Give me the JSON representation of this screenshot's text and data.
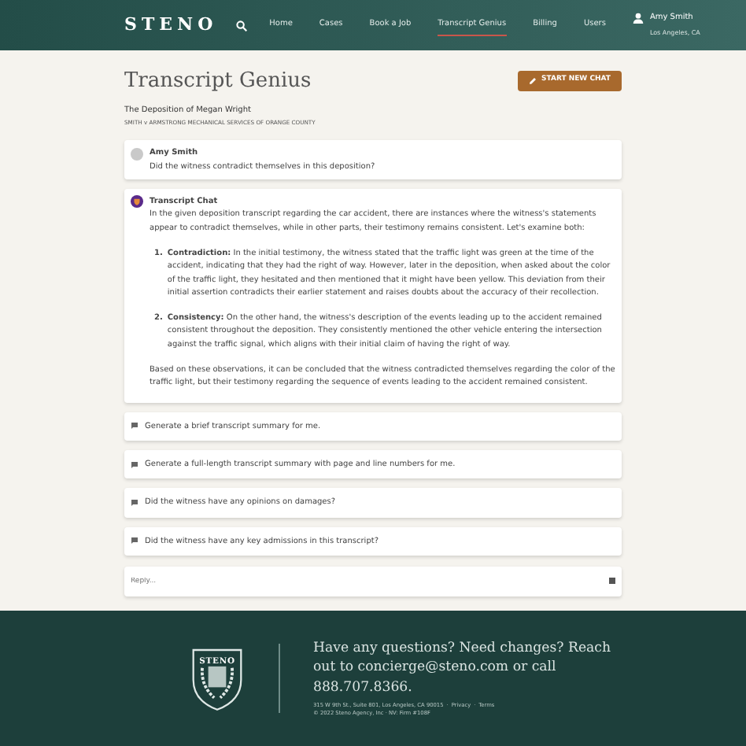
{
  "header": {
    "logo": "STENO",
    "nav": [
      {
        "label": "Home",
        "selected": false
      },
      {
        "label": "Cases",
        "selected": false
      },
      {
        "label": "Book a Job",
        "selected": false
      },
      {
        "label": "Transcript Genius",
        "selected": true
      },
      {
        "label": "Billing",
        "selected": false
      },
      {
        "label": "Users",
        "selected": false
      }
    ],
    "user": {
      "name": "Amy Smith",
      "location": "Los Angeles, CA"
    }
  },
  "page": {
    "title": "Transcript Genius",
    "button": "START NEW CHAT",
    "case_title": "The Deposition of Megan Wright",
    "case_subtitle": "SMITH v ARMSTRONG MECHANICAL SERVICES OF ORANGE COUNTY"
  },
  "messages": [
    {
      "kind": "user",
      "author": "Amy Smith",
      "text": "Did the witness contradict themselves in this deposition?"
    },
    {
      "kind": "bot",
      "author": "Transcript Chat",
      "intro": "In the given deposition transcript regarding the car accident, there are instances where the witness's statements appear to contradict themselves, while in other parts, their testimony remains consistent. Let's examine both:",
      "points": [
        {
          "number": "1.",
          "text": "**Contradiction:** In the initial testimony, the witness stated that the traffic light was green at the time of the accident, indicating that they had the right of way. However, later in the deposition, when asked about the color of the traffic light, they hesitated and then mentioned that it might have been yellow. This deviation from their initial assertion contradicts their earlier statement and raises doubts about the accuracy of their recollection."
        },
        {
          "number": "2.",
          "text": "**Consistency:** On the other hand, the witness's description of the events leading up to the accident remained consistent throughout the deposition. They consistently mentioned the other vehicle entering the intersection against the traffic signal, which aligns with their initial claim of having the right of way."
        }
      ],
      "conclusion": "Based on these observations, it can be concluded that the witness contradicted themselves regarding the color of the traffic light, but their testimony regarding the sequence of events leading to the accident remained consistent."
    }
  ],
  "suggestions": [
    "Generate a brief transcript summary for me.",
    "Generate a full-length transcript summary with page and line numbers for me.",
    "Did the witness have any opinions on damages?",
    "Did the witness have any key admissions in this transcript?"
  ],
  "reply": {
    "placeholder": "Reply..."
  },
  "footer": {
    "logo": "STENO",
    "contact": "Have any questions? Need changes? Reach out to concierge@steno.com or call 888.707.8366.",
    "address": "315 W 9th St., Suite 801, Los Angeles, CA 90015",
    "separator": "·",
    "links": [
      "Privacy",
      "Terms"
    ],
    "copyright": "© 2022 Steno Agency, Inc · NV: Firm #108F"
  }
}
